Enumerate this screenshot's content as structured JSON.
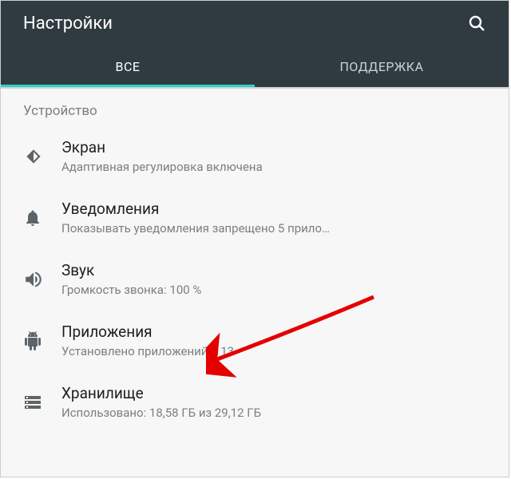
{
  "header": {
    "title": "Настройки"
  },
  "tabs": {
    "all": "ВСЕ",
    "support": "ПОДДЕРЖКА"
  },
  "section": {
    "device": "Устройство"
  },
  "rows": {
    "display": {
      "title": "Экран",
      "subtitle": "Адаптивная регулировка включена"
    },
    "notifications": {
      "title": "Уведомления",
      "subtitle": "Показывать уведомления запрещено 5 прило…"
    },
    "sound": {
      "title": "Звук",
      "subtitle": "Громкость звонка: 100 %"
    },
    "apps": {
      "title": "Приложения",
      "subtitle": "Установлено приложений: 113"
    },
    "storage": {
      "title": "Хранилище",
      "subtitle": "Использовано: 18,58 ГБ из 29,12 ГБ"
    }
  }
}
